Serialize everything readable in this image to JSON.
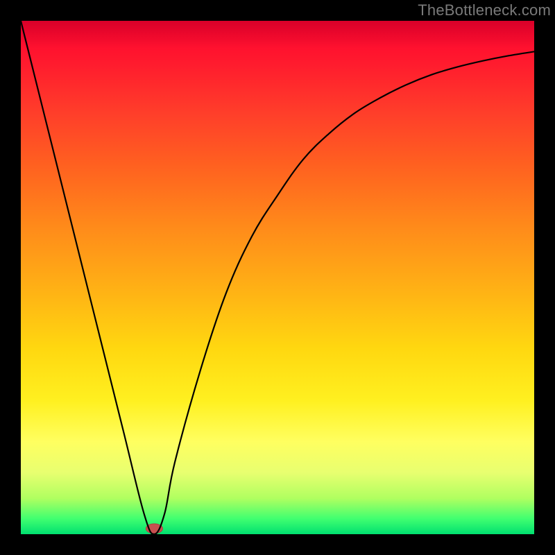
{
  "watermark": "TheBottleneck.com",
  "chart_data": {
    "type": "line",
    "title": "",
    "xlabel": "",
    "ylabel": "",
    "xlim": [
      0,
      100
    ],
    "ylim": [
      0,
      100
    ],
    "series": [
      {
        "name": "curve",
        "x": [
          0,
          5,
          10,
          15,
          20,
          24,
          26,
          28,
          30,
          35,
          40,
          45,
          50,
          55,
          60,
          65,
          70,
          75,
          80,
          85,
          90,
          95,
          100
        ],
        "y": [
          100,
          80,
          60,
          40,
          20,
          4,
          0,
          4,
          14,
          32,
          47,
          58,
          66,
          73,
          78,
          82,
          85,
          87.5,
          89.5,
          91,
          92.2,
          93.2,
          94
        ]
      }
    ],
    "marker": {
      "x": 26,
      "y": 0
    },
    "background_gradient": [
      "#ff0030",
      "#ff8a1a",
      "#fff020",
      "#00e070"
    ]
  }
}
